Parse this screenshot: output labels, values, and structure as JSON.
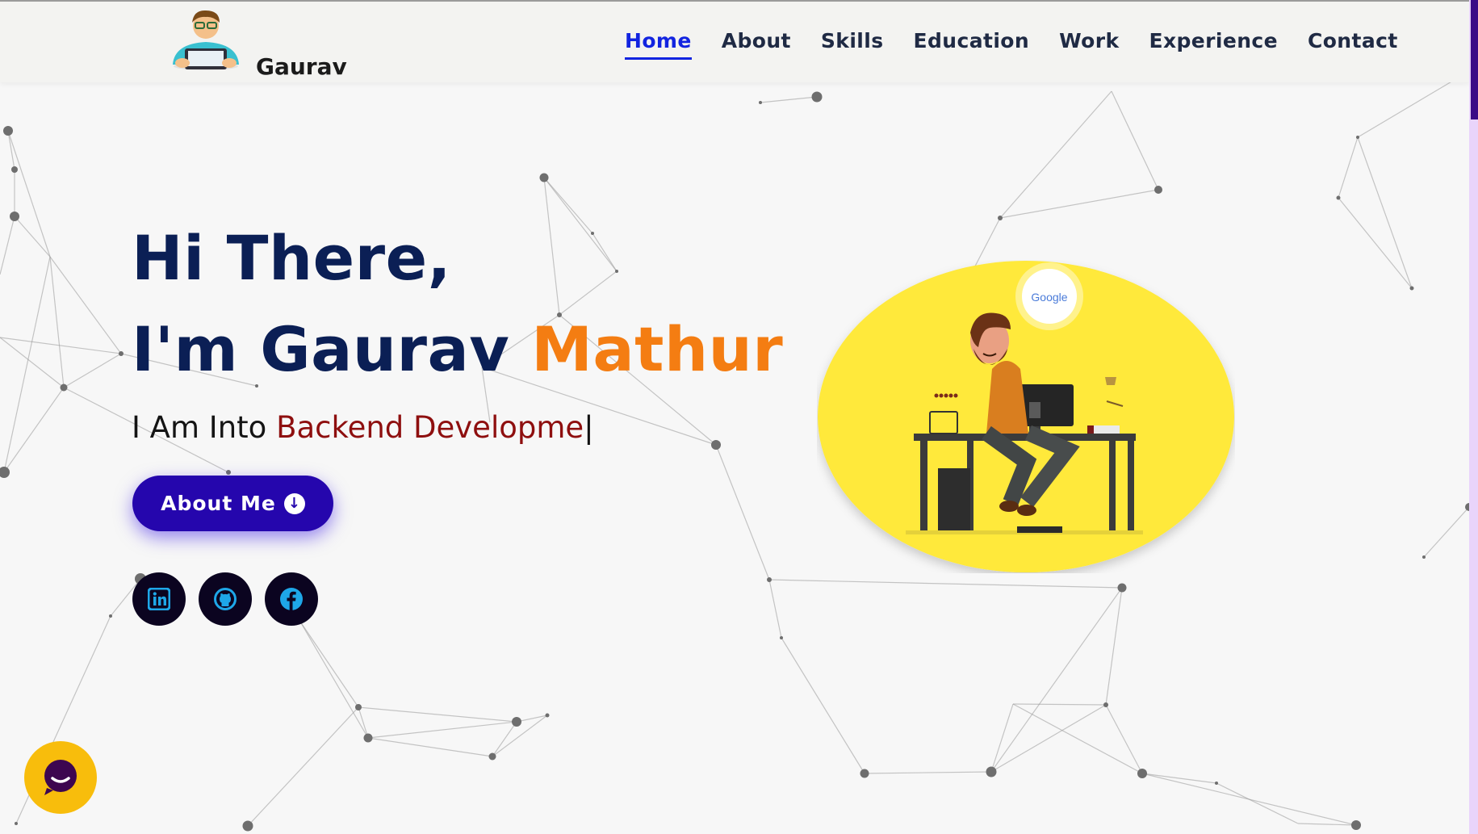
{
  "header": {
    "brand": "Gaurav",
    "nav": [
      {
        "label": "Home",
        "active": true
      },
      {
        "label": "About"
      },
      {
        "label": "Skills"
      },
      {
        "label": "Education"
      },
      {
        "label": "Work"
      },
      {
        "label": "Experience"
      },
      {
        "label": "Contact"
      }
    ]
  },
  "hero": {
    "greeting": "Hi There,",
    "name_prefix": "I'm Gaurav ",
    "surname": "Mathur",
    "role_prefix": "I Am Into ",
    "role_typed": "Backend Developme",
    "cursor": "|",
    "about_button": "About Me",
    "bubble_text": "Google"
  },
  "icons": {
    "logo": "developer-avatar-icon",
    "about_arrow": "arrow-down-circle-icon",
    "socials": [
      "linkedin-icon",
      "github-icon",
      "facebook-icon"
    ],
    "chat": "chat-icon"
  },
  "colors": {
    "heading": "#0b1f55",
    "accent_orange": "#f47d12",
    "accent_red": "#8e0f0f",
    "nav_active": "#1224e0",
    "button": "#2506ad",
    "social_bg": "#0b0420",
    "social_icon": "#1ea7e8",
    "illustration_bg": "#ffe93a",
    "chat_bg": "#f8bd0c"
  }
}
